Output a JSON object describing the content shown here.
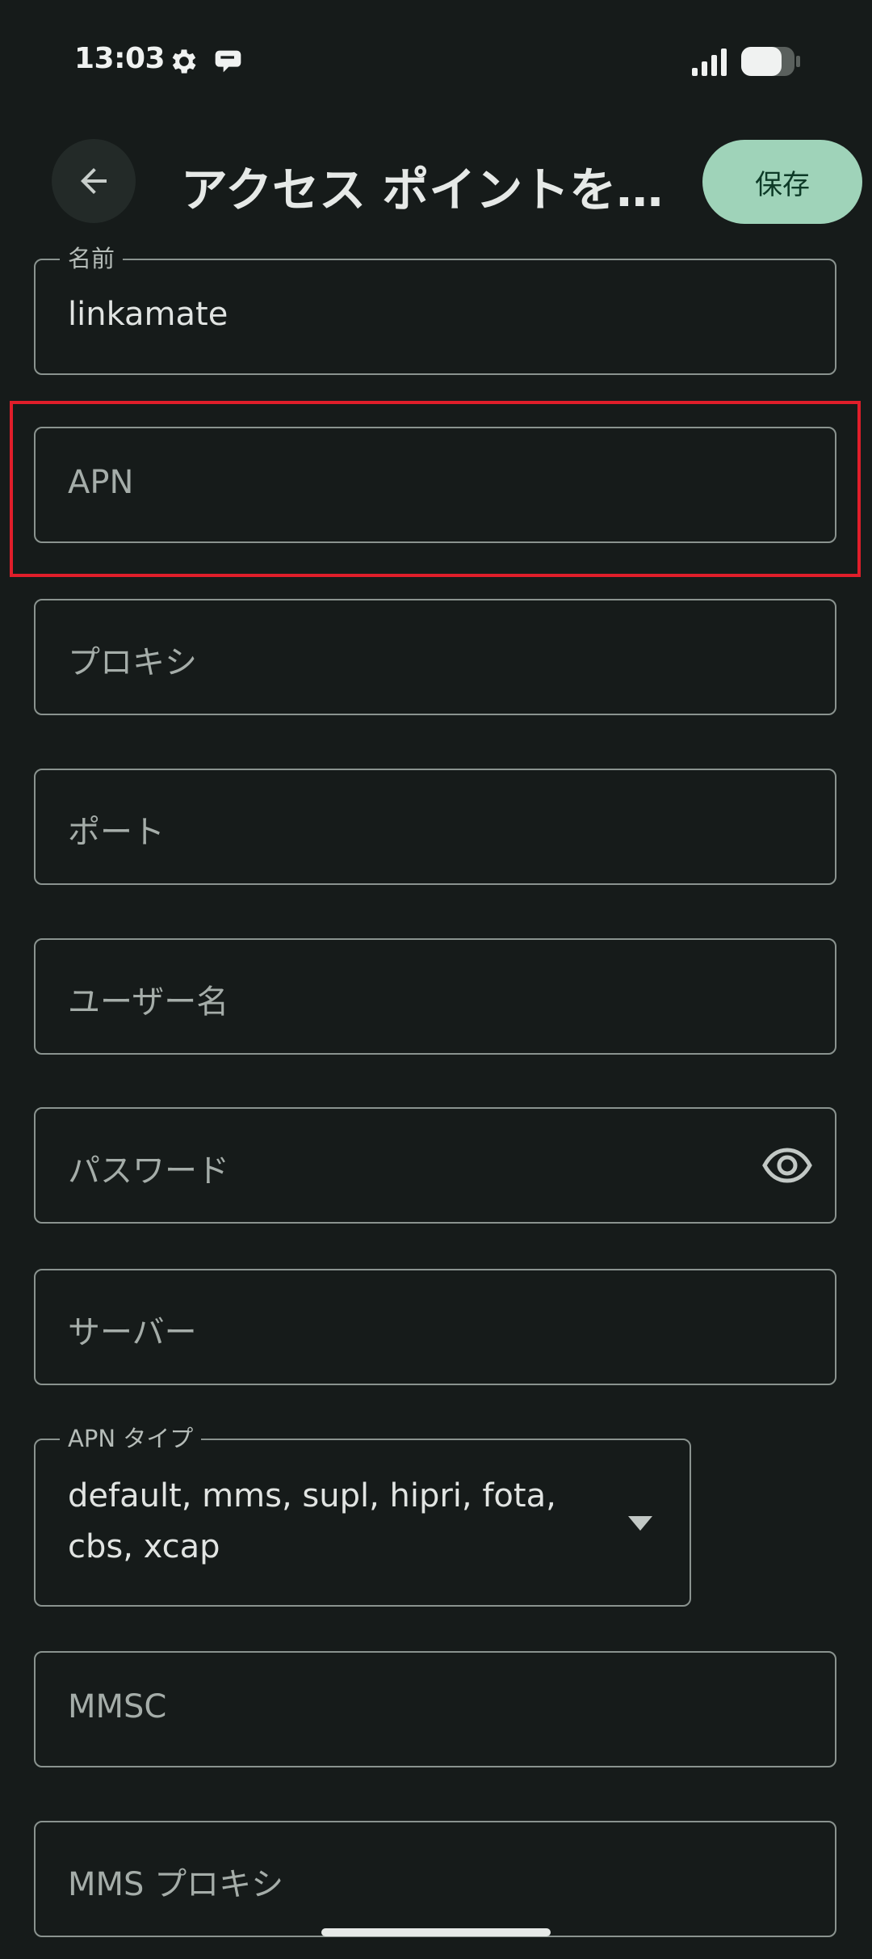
{
  "status_bar": {
    "time": "13:03",
    "icons": [
      "gear-icon",
      "chat-bubble-icon",
      "signal-icon",
      "battery-icon"
    ]
  },
  "app_bar": {
    "back_icon": "arrow-left-icon",
    "title": "アクセス ポイントを…",
    "save_label": "保存"
  },
  "fields": {
    "name": {
      "label": "名前",
      "value": "linkamate"
    },
    "apn": {
      "placeholder": "APN"
    },
    "proxy": {
      "placeholder": "プロキシ"
    },
    "port": {
      "placeholder": "ポート"
    },
    "username": {
      "placeholder": "ユーザー名"
    },
    "password": {
      "placeholder": "パスワード",
      "icon": "eye-icon"
    },
    "server": {
      "placeholder": "サーバー"
    },
    "apn_type": {
      "label": "APN タイプ",
      "value": "default, mms, supl, hipri, fota, cbs, xcap",
      "icon": "dropdown-arrow-icon"
    },
    "mmsc": {
      "placeholder": "MMSC"
    },
    "mms_proxy": {
      "placeholder": "MMS プロキシ"
    }
  },
  "colors": {
    "background": "#161b1a",
    "accent": "#9fd3b9",
    "highlight": "#e01e2a"
  }
}
